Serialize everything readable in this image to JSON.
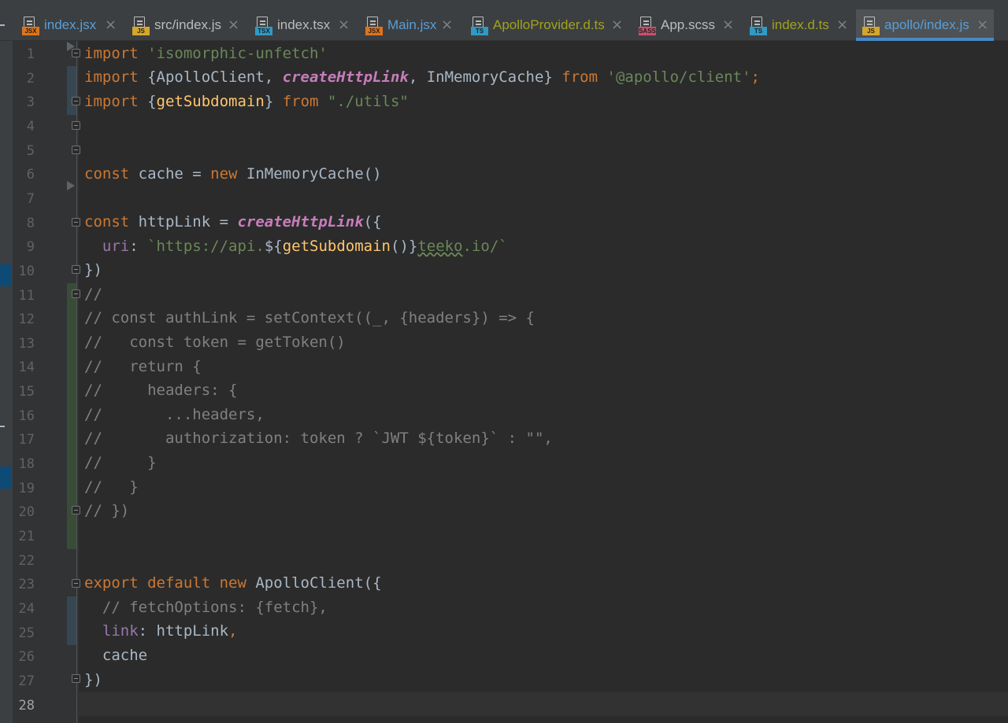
{
  "tabs": [
    {
      "label": "index.jsx",
      "badge": "JSX",
      "color": "#5a9ed6",
      "badge_color": "#e0741a",
      "active": false
    },
    {
      "label": "src/index.js",
      "badge": "JS",
      "color": "#bbbbbb",
      "badge_color": "#d4a72c",
      "active": false
    },
    {
      "label": "index.tsx",
      "badge": "TSX",
      "color": "#bbbbbb",
      "badge_color": "#2f9ac4",
      "active": false
    },
    {
      "label": "Main.jsx",
      "badge": "JSX",
      "color": "#5a9ed6",
      "badge_color": "#e0741a",
      "active": false
    },
    {
      "label": "ApolloProvider.d.ts",
      "badge": "TS",
      "color": "#a1a21c",
      "badge_color": "#2f9ac4",
      "active": false
    },
    {
      "label": "App.scss",
      "badge": "SASS",
      "color": "#bbbbbb",
      "badge_color": "#c9506f",
      "active": false
    },
    {
      "label": "index.d.ts",
      "badge": "TS",
      "color": "#a1a21c",
      "badge_color": "#2f9ac4",
      "active": false
    },
    {
      "label": "apollo/index.js",
      "badge": "JS",
      "color": "#5a9ed6",
      "badge_color": "#d4a72c",
      "active": true
    }
  ],
  "close_glyph": "×",
  "line_numbers": [
    "1",
    "2",
    "3",
    "4",
    "5",
    "6",
    "7",
    "8",
    "9",
    "10",
    "11",
    "12",
    "13",
    "14",
    "15",
    "16",
    "17",
    "18",
    "19",
    "20",
    "21",
    "22",
    "23",
    "24",
    "25",
    "26",
    "27",
    "28"
  ],
  "current_line": "28",
  "colors": {
    "editor_bg": "#2b2b2b",
    "keyword": "#cc7832",
    "string": "#6a8759",
    "function": "#ffc66d",
    "property": "#9876aa",
    "comment": "#808080",
    "accent": "#4a88c7"
  },
  "code": {
    "l1": {
      "kw": "import",
      "str": " 'isomorphic-unfetch'"
    },
    "l2": {
      "kw1": "import",
      "t1": " {ApolloClient, ",
      "fn": "createHttpLink",
      "t2": ", InMemoryCache} ",
      "kw2": "from",
      "str": " '@apollo/client'",
      "semi": ";"
    },
    "l3": {
      "kw1": "import",
      "t1": " {",
      "fn": "getSubdomain",
      "t2": "} ",
      "kw2": "from",
      "str": " \"./utils\""
    },
    "l6": {
      "kw1": "const",
      "t1": " cache = ",
      "kw2": "new",
      "t2": " InMemoryCache()"
    },
    "l8": {
      "kw": "const",
      "t1": " httpLink = ",
      "fn": "createHttpLink",
      "t2": "({"
    },
    "l9": {
      "indent": "  ",
      "prop": "uri",
      "t1": ": ",
      "str1": "`https://api.",
      "t2": "${",
      "fn": "getSubdomain",
      "t3": "()}",
      "squig": "teeko",
      "str2": ".io/`"
    },
    "l10": {
      "t": "})"
    },
    "l11": "//",
    "l12": "// const authLink = setContext((_, {headers}) => {",
    "l13": "//   const token = getToken()",
    "l14": "//   return {",
    "l15": "//     headers: {",
    "l16": "//       ...headers,",
    "l17": "//       authorization: token ? `JWT ${token}` : \"\",",
    "l18": "//     }",
    "l19": "//   }",
    "l20": "// })",
    "l23": {
      "kw1": "export",
      "kw2": " default",
      "kw3": " new",
      "t": " ApolloClient({"
    },
    "l24": {
      "indent": "  ",
      "cmt": "// fetchOptions: {fetch},"
    },
    "l25": {
      "indent": "  ",
      "prop": "link",
      "t": ": httpLink",
      "comma": ","
    },
    "l26": {
      "t": "  cache"
    },
    "l27": {
      "t": "})"
    }
  }
}
